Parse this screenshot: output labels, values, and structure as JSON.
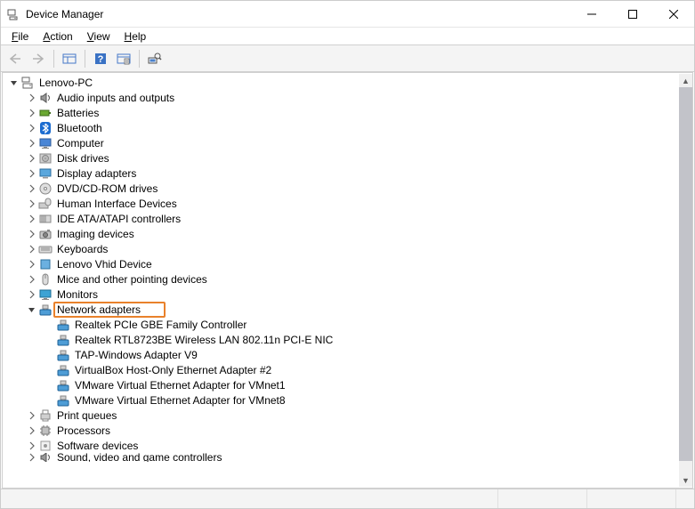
{
  "title": "Device Manager",
  "menu": {
    "file": "File",
    "action": "Action",
    "view": "View",
    "help": "Help"
  },
  "tree": [
    {
      "depth": 0,
      "expand": "open",
      "icon": "printer",
      "label": "Lenovo-PC",
      "hl": false
    },
    {
      "depth": 1,
      "expand": "closed",
      "icon": "speaker",
      "label": "Audio inputs and outputs",
      "hl": false
    },
    {
      "depth": 1,
      "expand": "closed",
      "icon": "battery",
      "label": "Batteries",
      "hl": false
    },
    {
      "depth": 1,
      "expand": "closed",
      "icon": "bluetooth",
      "label": "Bluetooth",
      "hl": false
    },
    {
      "depth": 1,
      "expand": "closed",
      "icon": "monitor",
      "label": "Computer",
      "hl": false
    },
    {
      "depth": 1,
      "expand": "closed",
      "icon": "disk",
      "label": "Disk drives",
      "hl": false
    },
    {
      "depth": 1,
      "expand": "closed",
      "icon": "display",
      "label": "Display adapters",
      "hl": false
    },
    {
      "depth": 1,
      "expand": "closed",
      "icon": "dvd",
      "label": "DVD/CD-ROM drives",
      "hl": false
    },
    {
      "depth": 1,
      "expand": "closed",
      "icon": "hid",
      "label": "Human Interface Devices",
      "hl": false
    },
    {
      "depth": 1,
      "expand": "closed",
      "icon": "ide",
      "label": "IDE ATA/ATAPI controllers",
      "hl": false
    },
    {
      "depth": 1,
      "expand": "closed",
      "icon": "imaging",
      "label": "Imaging devices",
      "hl": false
    },
    {
      "depth": 1,
      "expand": "closed",
      "icon": "keyboard",
      "label": "Keyboards",
      "hl": false
    },
    {
      "depth": 1,
      "expand": "closed",
      "icon": "vhid",
      "label": "Lenovo Vhid Device",
      "hl": false
    },
    {
      "depth": 1,
      "expand": "closed",
      "icon": "mouse",
      "label": "Mice and other pointing devices",
      "hl": false
    },
    {
      "depth": 1,
      "expand": "closed",
      "icon": "monitor2",
      "label": "Monitors",
      "hl": false
    },
    {
      "depth": 1,
      "expand": "open",
      "icon": "network",
      "label": "Network adapters",
      "hl": true
    },
    {
      "depth": 2,
      "expand": "none",
      "icon": "network",
      "label": "Realtek PCIe GBE Family Controller",
      "hl": false
    },
    {
      "depth": 2,
      "expand": "none",
      "icon": "network",
      "label": "Realtek RTL8723BE Wireless LAN 802.11n PCI-E NIC",
      "hl": false
    },
    {
      "depth": 2,
      "expand": "none",
      "icon": "network",
      "label": "TAP-Windows Adapter V9",
      "hl": false
    },
    {
      "depth": 2,
      "expand": "none",
      "icon": "network",
      "label": "VirtualBox Host-Only Ethernet Adapter #2",
      "hl": false
    },
    {
      "depth": 2,
      "expand": "none",
      "icon": "network",
      "label": "VMware Virtual Ethernet Adapter for VMnet1",
      "hl": false
    },
    {
      "depth": 2,
      "expand": "none",
      "icon": "network",
      "label": "VMware Virtual Ethernet Adapter for VMnet8",
      "hl": false
    },
    {
      "depth": 1,
      "expand": "closed",
      "icon": "printerq",
      "label": "Print queues",
      "hl": false
    },
    {
      "depth": 1,
      "expand": "closed",
      "icon": "cpu",
      "label": "Processors",
      "hl": false
    },
    {
      "depth": 1,
      "expand": "closed",
      "icon": "software",
      "label": "Software devices",
      "hl": false
    },
    {
      "depth": 1,
      "expand": "closed",
      "icon": "speaker",
      "label": "Sound, video and game controllers",
      "hl": false,
      "cut": true
    }
  ]
}
